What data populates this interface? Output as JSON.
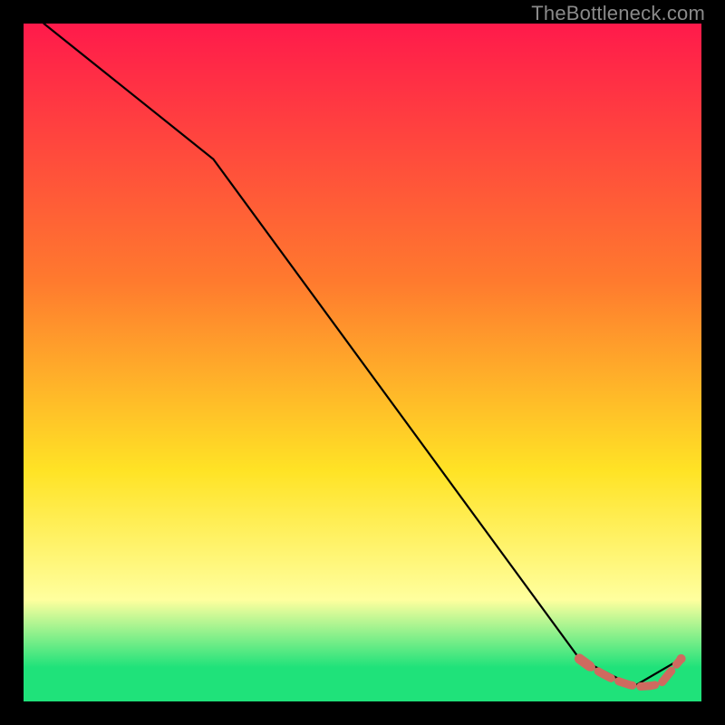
{
  "watermark": "TheBottleneck.com",
  "colors": {
    "bg": "#000000",
    "grad_top": "#ff1a4b",
    "grad_upper": "#ff7a2e",
    "grad_mid": "#ffe325",
    "grad_lightband": "#ffff9e",
    "grad_green": "#1fe27a",
    "line": "#000000",
    "marker_fill": "#cf6a5f",
    "marker_stroke": "#cf6a5f"
  },
  "chart_data": {
    "type": "line",
    "title": "",
    "xlabel": "",
    "ylabel": "",
    "xlim": [
      0,
      100
    ],
    "ylim": [
      0,
      100
    ],
    "series": [
      {
        "name": "curve",
        "x": [
          3,
          28,
          82,
          90,
          97
        ],
        "y": [
          100,
          80,
          6.3,
          2.2,
          6.3
        ]
      },
      {
        "name": "markers",
        "x": [
          82,
          83.5,
          85,
          86.5,
          88,
          89.5,
          91,
          92.5,
          94,
          97
        ],
        "y": [
          6.3,
          5.2,
          4.3,
          3.5,
          2.9,
          2.4,
          2.2,
          2.3,
          2.6,
          6.3
        ]
      }
    ]
  }
}
